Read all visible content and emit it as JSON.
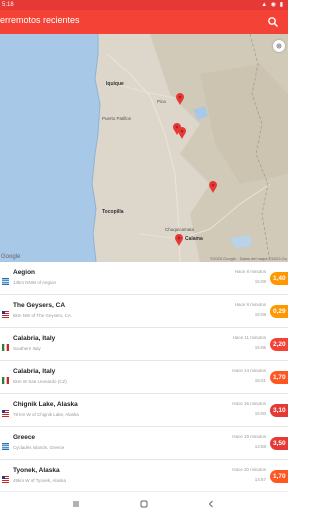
{
  "status_bar": {
    "time": "5:18",
    "icons": "▲ ◉ ▮"
  },
  "app_bar": {
    "title": "erremotos recientes",
    "search_icon": "search-icon"
  },
  "map": {
    "labels": {
      "iquique": "Iquique",
      "pica": "Pica",
      "puerto_patillos": "Puerto Patillos",
      "tocopilla": "Tocopilla",
      "chuquicamata": "Chuquicamata",
      "calama": "Calama"
    },
    "google": "Google",
    "attribution": "©2023 Google · Datos del mapa ©2023 Go"
  },
  "quakes": [
    {
      "place": "Aegion",
      "detail": "13km NNW of Aegion",
      "ago": "Hace 8 minutos",
      "time": "15:08",
      "mag": "1,40",
      "mag_color": "#ff9800",
      "flag": "greece"
    },
    {
      "place": "The Geysers, CA",
      "detail": "6km NW of The Geysers, CA",
      "ago": "Hace 8 minutos",
      "time": "15:08",
      "mag": "0,29",
      "mag_color": "#ff9800",
      "flag": "usa"
    },
    {
      "place": "Calabria, Italy",
      "detail": "Southern Italy",
      "ago": "Hace 11 minutos",
      "time": "15:06",
      "mag": "2,20",
      "mag_color": "#f44336",
      "flag": "italy"
    },
    {
      "place": "Calabria, Italy",
      "detail": "5km W San Leonardo (CZ)",
      "ago": "Hace 14 minutos",
      "time": "15:01",
      "mag": "1,70",
      "mag_color": "#ff5722",
      "flag": "italy"
    },
    {
      "place": "Chignik Lake, Alaska",
      "detail": "78 km W of Chignik Lake, Alaska",
      "ago": "Hace 16 minutos",
      "time": "15:00",
      "mag": "3,10",
      "mag_color": "#e53935",
      "flag": "usa"
    },
    {
      "place": "Greece",
      "detail": "Cyclades Islands, Greece",
      "ago": "Hace 19 minutos",
      "time": "14:58",
      "mag": "3,50",
      "mag_color": "#e53935",
      "flag": "greece"
    },
    {
      "place": "Tyonek, Alaska",
      "detail": "45km W of Tyonek, Alaska",
      "ago": "Hace 20 minutos",
      "time": "14:57",
      "mag": "1,70",
      "mag_color": "#ff5722",
      "flag": "usa"
    }
  ]
}
